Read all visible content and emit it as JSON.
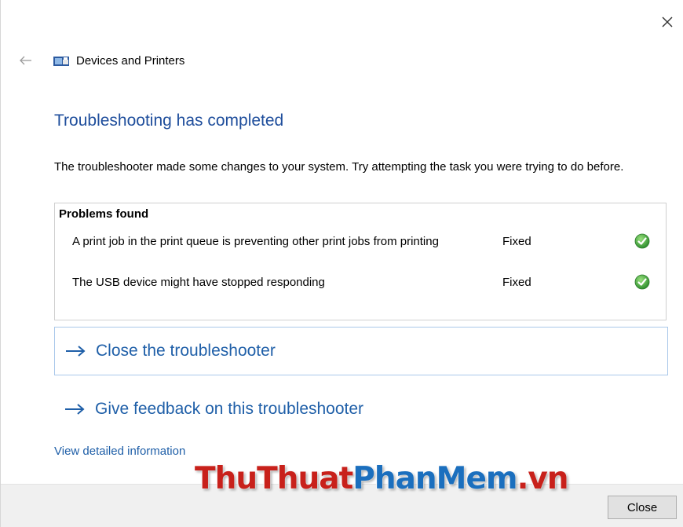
{
  "window": {
    "nav_title": "Devices and Printers"
  },
  "main": {
    "title": "Troubleshooting has completed",
    "description": "The troubleshooter made some changes to your system. Try attempting the task you were trying to do before."
  },
  "problems": {
    "header": "Problems found",
    "items": [
      {
        "text": "A print job in the print queue is preventing other print jobs from printing",
        "status": "Fixed"
      },
      {
        "text": "The USB device might have stopped responding",
        "status": "Fixed"
      }
    ]
  },
  "actions": {
    "close_troubleshooter": "Close the troubleshooter",
    "give_feedback": "Give feedback on this troubleshooter"
  },
  "links": {
    "view_details": "View detailed information"
  },
  "footer": {
    "close_label": "Close"
  },
  "watermark": {
    "part1": "ThuThuat",
    "part2": "PhanMem",
    "part3": ".vn"
  },
  "colors": {
    "title_blue": "#1f4e9c",
    "link_blue": "#1f5fa8",
    "check_green": "#3aa33a",
    "watermark_red": "#c8211b",
    "watermark_blue": "#1b6fbe"
  },
  "icons": {
    "close": "close-icon",
    "back": "back-arrow-icon",
    "app": "devices-printers-icon",
    "check": "green-check-icon",
    "arrow": "right-arrow-icon"
  }
}
